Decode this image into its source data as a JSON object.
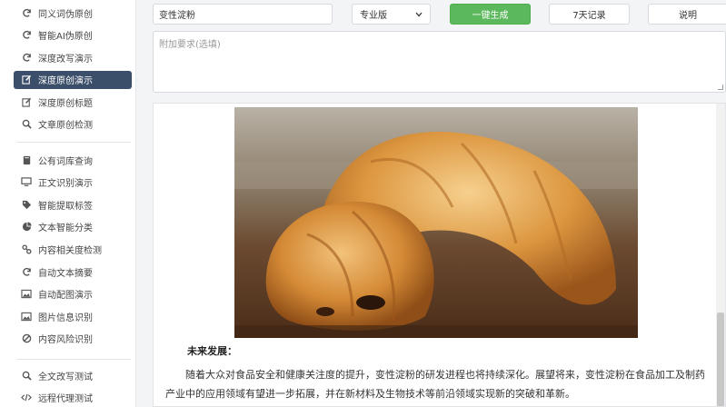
{
  "sidebar": {
    "group1": [
      {
        "label": "同义词伪原创",
        "icon": "refresh-icon"
      },
      {
        "label": "智能AI伪原创",
        "icon": "refresh-icon"
      },
      {
        "label": "深度改写演示",
        "icon": "refresh-icon"
      },
      {
        "label": "深度原创演示",
        "icon": "edit-icon",
        "active": true
      },
      {
        "label": "深度原创标题",
        "icon": "edit-icon"
      },
      {
        "label": "文章原创检测",
        "icon": "search-icon"
      }
    ],
    "group2": [
      {
        "label": "公有词库查询",
        "icon": "book-icon"
      },
      {
        "label": "正文识别演示",
        "icon": "monitor-icon"
      },
      {
        "label": "智能提取标签",
        "icon": "tag-icon"
      },
      {
        "label": "文本智能分类",
        "icon": "pie-chart-icon"
      },
      {
        "label": "内容相关度检测",
        "icon": "link-icon"
      },
      {
        "label": "自动文本摘要",
        "icon": "refresh-icon"
      },
      {
        "label": "自动配图演示",
        "icon": "image-icon"
      },
      {
        "label": "图片信息识别",
        "icon": "image-icon"
      },
      {
        "label": "内容风险识别",
        "icon": "ban-icon"
      }
    ],
    "group3": [
      {
        "label": "全文改写测试",
        "icon": "search-icon"
      },
      {
        "label": "远程代理测试",
        "icon": "code-icon"
      }
    ]
  },
  "toolbar": {
    "topic_value": "变性淀粉",
    "version_selected": "专业版",
    "generate_label": "一键生成",
    "history_label": "7天记录",
    "help_label": "说明",
    "requirements_placeholder": "附加要求(选填)"
  },
  "article": {
    "heading": "未来发展：",
    "paragraph": "随着大众对食品安全和健康关注度的提升，变性淀粉的研发进程也将持续深化。展望将来，变性淀粉在食品加工及制药产业中的应用领域有望进一步拓展，并在新材料及生物技术等前沿领域实现新的突破和革新。"
  },
  "colors": {
    "active_bg": "#3c4f6a",
    "primary_btn": "#5cb85c"
  }
}
